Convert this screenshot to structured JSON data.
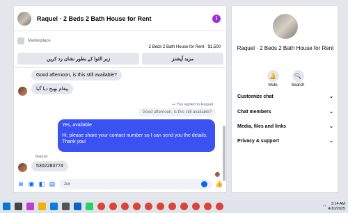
{
  "chat": {
    "title": "Raquel · 2 Beds 2 Bath House for Rent",
    "marketplace_label": "Marketplace",
    "listing": "2 Beds 2 Bath House for Rent · $1,500",
    "buttons": [
      "زبر الثوا کے بطور نشان زد کریں",
      "مزید آپشنز"
    ],
    "messages": {
      "greeting_in": "Good afternoon, is this still available?",
      "reply_in": "پیغام بھیج دیا گیا",
      "reply_meta": "You replied to Raquel",
      "quoted": "Good afternoon, is this still available?",
      "outgoing_line1": "Yes, available",
      "outgoing_line2": "Hi, please share your contact number so I can send you the details. Thank you!",
      "sender_name": "Raquel",
      "number_in": "5302283774"
    },
    "composer_placeholder": "Aa"
  },
  "info": {
    "name": "Raquel · 2 Beds 2 Bath House for Rent",
    "actions": [
      "Mute",
      "Search"
    ],
    "sections": [
      "Customize chat",
      "Chat members",
      "Media, files and links",
      "Privacy & support"
    ]
  },
  "taskbar": {
    "time": "3:14 AM",
    "date": "4/10/2025",
    "icons": [
      "start-icon",
      "search-icon",
      "copilot-icon",
      "file-explorer-icon",
      "edge-icon",
      "store-icon",
      "outlook-icon",
      "whatsapp-icon",
      "chrome-icon",
      "chrome-icon",
      "chrome-icon",
      "chrome-icon",
      "chrome-icon",
      "chrome-icon",
      "chrome-icon",
      "chrome-icon",
      "chrome-icon",
      "chrome-icon",
      "chrome-icon"
    ],
    "icon_colors": [
      "#0078d4",
      "#444",
      "#c23bd4",
      "#f2b10c",
      "#0c7bdc",
      "#555",
      "#0a64c8",
      "#25d366",
      "#db4437",
      "#db4437",
      "#db4437",
      "#db4437",
      "#db4437",
      "#db4437",
      "#db4437",
      "#db4437",
      "#db4437",
      "#db4437",
      "#db4437"
    ]
  },
  "colors": {
    "accent": "#0866ff",
    "outgoing_bubble": "#3b52f2",
    "info_button": "#9b2fd6"
  }
}
